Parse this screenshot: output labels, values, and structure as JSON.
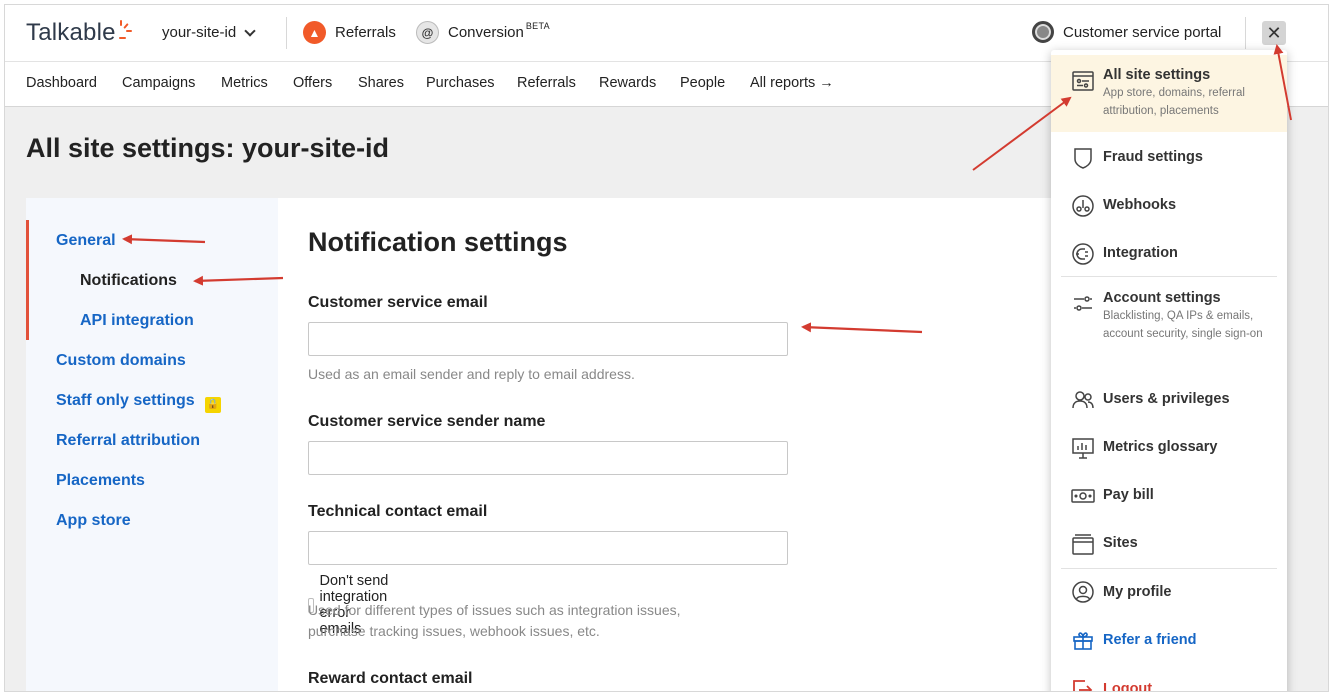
{
  "header": {
    "logo": "Talkable",
    "site_id": "your-site-id",
    "products": [
      {
        "label": "Referrals"
      },
      {
        "label": "Conversion",
        "badge": "BETA"
      }
    ],
    "portal": "Customer service portal",
    "close": "✕"
  },
  "nav": [
    "Dashboard",
    "Campaigns",
    "Metrics",
    "Offers",
    "Shares",
    "Purchases",
    "Referrals",
    "Rewards",
    "People",
    "All reports →"
  ],
  "page_title": "All site settings: your-site-id",
  "sidebar": {
    "items": [
      "General",
      "Notifications",
      "API integration",
      "Custom domains",
      "Staff only settings",
      "Referral attribution",
      "Placements",
      "App store"
    ]
  },
  "form": {
    "heading": "Notification settings",
    "cs_email_label": "Customer service email",
    "cs_email_value": "",
    "cs_email_help": "Used as an email sender and reply to email address.",
    "cs_name_label": "Customer service sender name",
    "cs_name_value": "",
    "tech_email_label": "Technical contact email",
    "tech_email_value": "",
    "tech_checkbox": "Don't send integration error emails",
    "tech_help_1": "Used for different types of issues such as integration issues,",
    "tech_help_2": "purchase tracking issues, webhook issues, etc.",
    "reward_email_label": "Reward contact email"
  },
  "menu": {
    "all_site_settings": {
      "title": "All site settings",
      "sub": "App store, domains, referral attribution, placements"
    },
    "fraud": "Fraud settings",
    "webhooks": "Webhooks",
    "integration": "Integration",
    "account": {
      "title": "Account settings",
      "sub": "Blacklisting, QA IPs & emails, account security, single sign-on"
    },
    "users": "Users & privileges",
    "metrics_glossary": "Metrics glossary",
    "pay_bill": "Pay bill",
    "sites": "Sites",
    "profile": "My profile",
    "refer": "Refer a friend",
    "logout": "Logout"
  },
  "colors": {
    "accent_red": "#e2513a",
    "link_blue": "#1666c5",
    "highlight": "#fdf5e2",
    "arrow": "#d33b30"
  }
}
